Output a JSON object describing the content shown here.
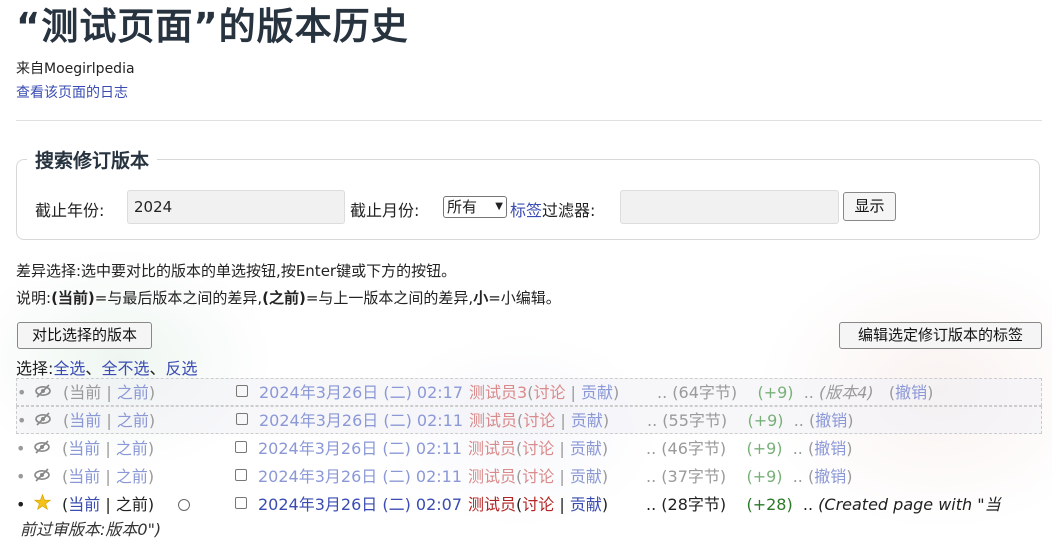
{
  "page": {
    "title": "“测试页面”的版本历史",
    "subtitle": "来自Moegirlpedia",
    "log_link": "查看该页面的日志"
  },
  "search": {
    "legend": "搜索修订版本",
    "year_label": "截止年份:",
    "year_value": "2024",
    "month_label": "截止月份:",
    "month_value": "所有",
    "tag_link": "标签",
    "tag_label_rest": "过滤器:",
    "tag_value": "",
    "show_button": "显示"
  },
  "help": {
    "diff_text": "差异选择:选中要对比的版本的单选按钮,按Enter键或下方的按钮。",
    "legend_prefix": "说明:",
    "cur_term": "(当前)",
    "cur_desc": "=与最后版本之间的差异,",
    "prev_term": "(之前)",
    "prev_desc": "=与上一版本之间的差异,",
    "minor_term": "小",
    "minor_desc": "=小编辑。"
  },
  "actions": {
    "compare_button": "对比选择的版本",
    "edit_tags_button": "编辑选定修订版本的标签",
    "select_label": "选择:",
    "select_all": "全选",
    "select_none": "全不选",
    "select_invert": "反选"
  },
  "revisions": [
    {
      "cur": "当前",
      "prev": "之前",
      "date": "2024年3月26日 (二) 02:17",
      "user": "测试员3",
      "talk": "讨论",
      "contribs": "贡献",
      "size": "(64字节)",
      "diff": "(+9)",
      "summary": "(版本4)",
      "undo": "撤销"
    },
    {
      "cur": "当前",
      "prev": "之前",
      "date": "2024年3月26日 (二) 02:11",
      "user": "测试员",
      "talk": "讨论",
      "contribs": "贡献",
      "size": "(55字节)",
      "diff": "(+9)",
      "undo": "撤销"
    },
    {
      "cur": "当前",
      "prev": "之前",
      "date": "2024年3月26日 (二) 02:11",
      "user": "测试员",
      "talk": "讨论",
      "contribs": "贡献",
      "size": "(46字节)",
      "diff": "(+9)",
      "undo": "撤销"
    },
    {
      "cur": "当前",
      "prev": "之前",
      "date": "2024年3月26日 (二) 02:11",
      "user": "测试员",
      "talk": "讨论",
      "contribs": "贡献",
      "size": "(37字节)",
      "diff": "(+9)",
      "undo": "撤销"
    },
    {
      "cur": "当前",
      "prev": "之前",
      "date": "2024年3月26日 (二) 02:07",
      "user": "测试员",
      "talk": "讨论",
      "contribs": "贡献",
      "size": "(28字节)",
      "diff": "(+28)",
      "summary": "(Created page with \"当",
      "summary_cont": "前过审版本:版本0\")"
    }
  ],
  "colors": {
    "link": "#3a4cb2",
    "user": "#b32424",
    "positive": "#2a7a2a",
    "title": "#283340"
  },
  "icons": {
    "hidden": "eye-slash-icon",
    "approved": "star-icon"
  }
}
